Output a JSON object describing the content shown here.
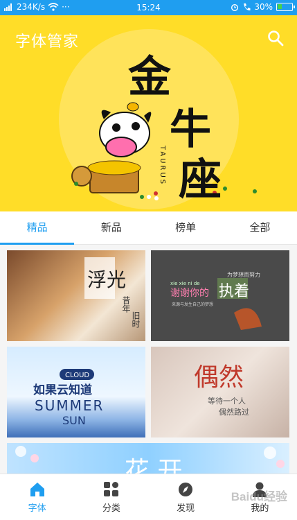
{
  "status_bar": {
    "network_speed": "234K/s",
    "more": "···",
    "time": "15:24",
    "battery": "30%",
    "battery_level": 0.3
  },
  "header": {
    "title": "字体管家",
    "search_icon": "search-icon"
  },
  "banner": {
    "line1": "金",
    "line2": "牛",
    "line3": "座",
    "latin": "TAURUS"
  },
  "tabs": [
    {
      "label": "精品",
      "active": true
    },
    {
      "label": "新品",
      "active": false
    },
    {
      "label": "榜单",
      "active": false
    },
    {
      "label": "全部",
      "active": false
    }
  ],
  "cards": {
    "card1": {
      "title": "浮光",
      "subtitle": "昔年",
      "subtitle2": "旧时"
    },
    "card2": {
      "line_small": "为梦想而努力",
      "pinyin": "xie xie ni de",
      "main": "谢谢你的",
      "big": "执着",
      "small": "来源与发生自己的梦想"
    },
    "card3": {
      "badge": "CLOUD",
      "main": "如果云知道",
      "en1": "SUMMER",
      "en2": "SUN"
    },
    "card4": {
      "main": "偶然",
      "line2": "等待一个人",
      "line3": "偶然路过"
    },
    "card5": {
      "main": "花 开"
    }
  },
  "bottom_nav": [
    {
      "label": "字体",
      "icon": "home-icon",
      "active": true
    },
    {
      "label": "分类",
      "icon": "category-icon",
      "active": false
    },
    {
      "label": "发现",
      "icon": "compass-icon",
      "active": false
    },
    {
      "label": "我的",
      "icon": "user-icon",
      "active": false
    }
  ],
  "watermark": "Baidu经验",
  "colors": {
    "accent": "#1f9ef0",
    "hero_bg": "#ffdd28"
  }
}
